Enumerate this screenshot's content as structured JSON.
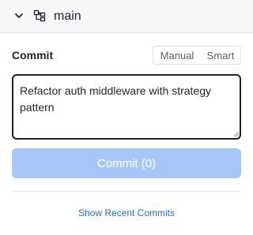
{
  "branch": {
    "name": "main",
    "chevron_icon": "chevron-down-icon",
    "branch_icon": "git-branch-icon"
  },
  "commit": {
    "label": "Commit",
    "modes": [
      "Manual",
      "Smart"
    ],
    "message": "Refactor auth middleware with strategy pattern",
    "button_label": "Commit (0)"
  },
  "footer": {
    "recent_label": "Show Recent Commits"
  },
  "colors": {
    "accent": "#1f6fd1",
    "button_disabled": "#a7c8f6",
    "header_bg": "#f6f7f9"
  }
}
